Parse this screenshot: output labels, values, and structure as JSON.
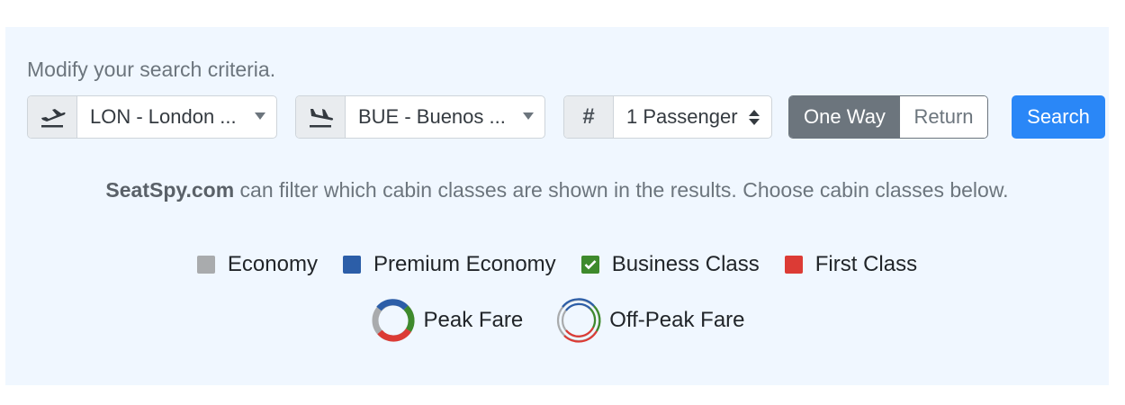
{
  "search": {
    "heading": "Modify your search criteria.",
    "origin": "LON - London ...",
    "destination": "BUE - Buenos ...",
    "passengers": "1 Passenger",
    "passenger_addon": "#",
    "trip_type": {
      "one_way": "One Way",
      "return": "Return",
      "selected": "one_way"
    },
    "search_label": "Search"
  },
  "info": {
    "brand": "SeatSpy.com",
    "text": " can filter which cabin classes are shown in the results. Choose cabin classes below."
  },
  "cabins": [
    {
      "label": "Economy",
      "color": "#a9abad",
      "checked": false
    },
    {
      "label": "Premium Economy",
      "color": "#2c5ea8",
      "checked": false
    },
    {
      "label": "Business Class",
      "color": "#3e8a2c",
      "checked": true
    },
    {
      "label": "First Class",
      "color": "#dc3b35",
      "checked": false
    }
  ],
  "fares": {
    "peak": "Peak Fare",
    "off_peak": "Off-Peak Fare"
  },
  "colors": {
    "accent": "#2a87f7",
    "panel": "#f0f7ff",
    "toggle_active": "#6c757d"
  }
}
